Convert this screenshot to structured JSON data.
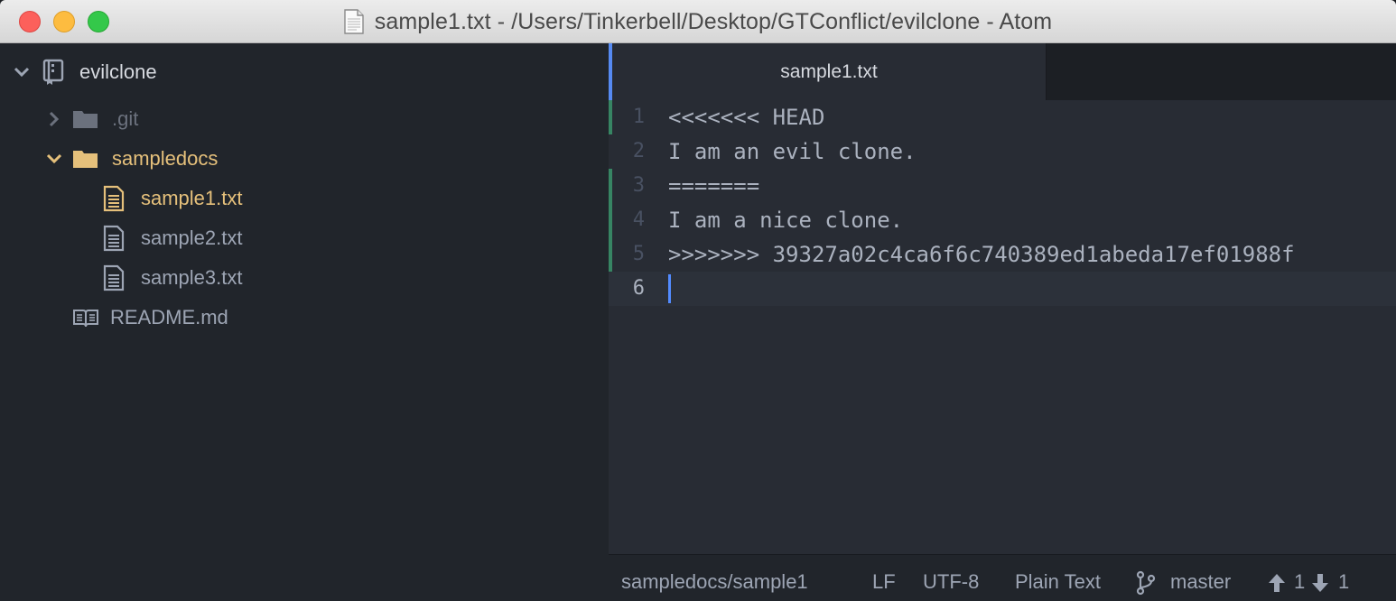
{
  "window": {
    "title": "sample1.txt - /Users/Tinkerbell/Desktop/GTConflict/evilclone - Atom"
  },
  "tree": {
    "root": {
      "label": "evilclone",
      "icon": "repo-icon",
      "expanded": true
    },
    "items": [
      {
        "label": ".git",
        "type": "folder",
        "expanded": false,
        "status": "ignored"
      },
      {
        "label": "sampledocs",
        "type": "folder",
        "expanded": true,
        "status": "modified"
      },
      {
        "label": "sample1.txt",
        "type": "file",
        "status": "modified"
      },
      {
        "label": "sample2.txt",
        "type": "file",
        "status": "normal"
      },
      {
        "label": "sample3.txt",
        "type": "file",
        "status": "normal"
      },
      {
        "label": "README.md",
        "type": "file",
        "status": "normal"
      }
    ]
  },
  "editor": {
    "active_tab": "sample1.txt",
    "lines": [
      {
        "number": "1",
        "text": "<<<<<<< HEAD"
      },
      {
        "number": "2",
        "text": "I am an evil clone."
      },
      {
        "number": "3",
        "text": "======="
      },
      {
        "number": "4",
        "text": "I am a nice clone."
      },
      {
        "number": "5",
        "text": ">>>>>>> 39327a02c4ca6f6c740389ed1abeda17ef01988f"
      },
      {
        "number": "6",
        "text": ""
      }
    ],
    "cursor_line": 6
  },
  "status_bar": {
    "file_path": "sampledocs/sample1",
    "line_ending": "LF",
    "encoding": "UTF-8",
    "grammar": "Plain Text",
    "branch": "master",
    "ahead": "1",
    "behind": "1"
  },
  "colors": {
    "accent": "#568af2",
    "modified": "#e5c07b",
    "added_gutter": "#43d08a"
  }
}
